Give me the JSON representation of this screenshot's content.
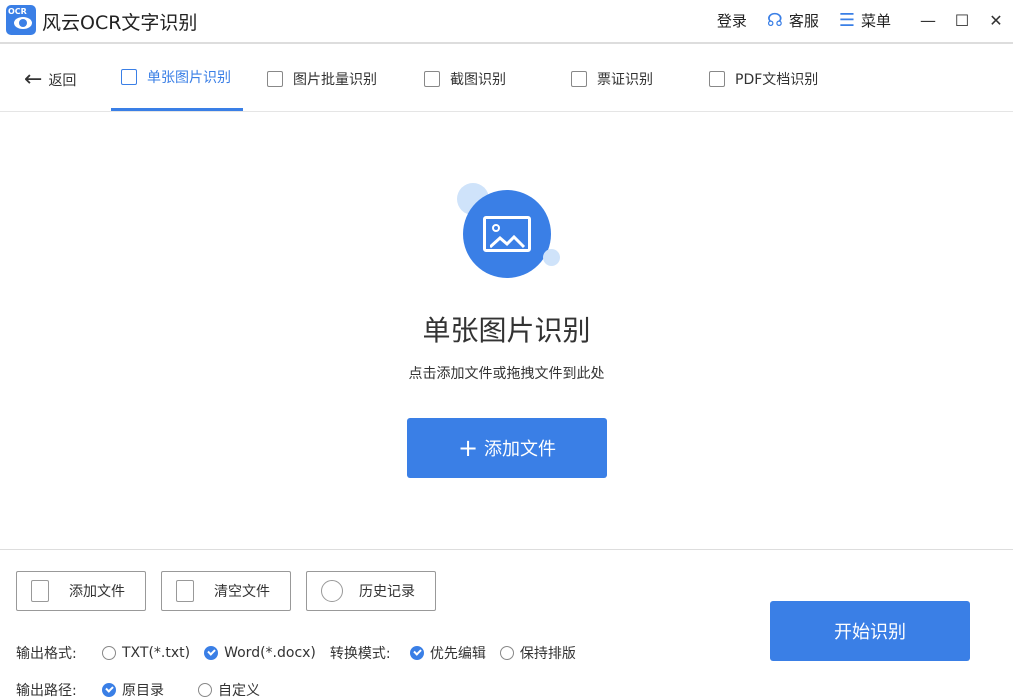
{
  "app": {
    "logo_text": "OCR",
    "title": "风云OCR文字识别",
    "login": "登录",
    "service": "客服",
    "menu": "菜单"
  },
  "nav": {
    "back": "返回",
    "tabs": [
      {
        "label": "单张图片识别"
      },
      {
        "label": "图片批量识别"
      },
      {
        "label": "截图识别"
      },
      {
        "label": "票证识别"
      },
      {
        "label": "PDF文档识别"
      }
    ]
  },
  "hero": {
    "title": "单张图片识别",
    "subtitle": "点击添加文件或拖拽文件到此处",
    "add_button": "添加文件",
    "plus": "+"
  },
  "toolbar": {
    "add": "添加文件",
    "clear": "清空文件",
    "history": "历史记录",
    "start": "开始识别"
  },
  "options": {
    "format_label": "输出格式:",
    "format_opts": [
      {
        "label": "TXT(*.txt)",
        "checked": false
      },
      {
        "label": "Word(*.docx)",
        "checked": true
      }
    ],
    "mode_label": "转换模式:",
    "mode_opts": [
      {
        "label": "优先编辑",
        "checked": true
      },
      {
        "label": "保持排版",
        "checked": false
      }
    ],
    "path_label": "输出路径:",
    "path_opts": [
      {
        "label": "原目录",
        "checked": true
      },
      {
        "label": "自定义",
        "checked": false
      }
    ]
  }
}
